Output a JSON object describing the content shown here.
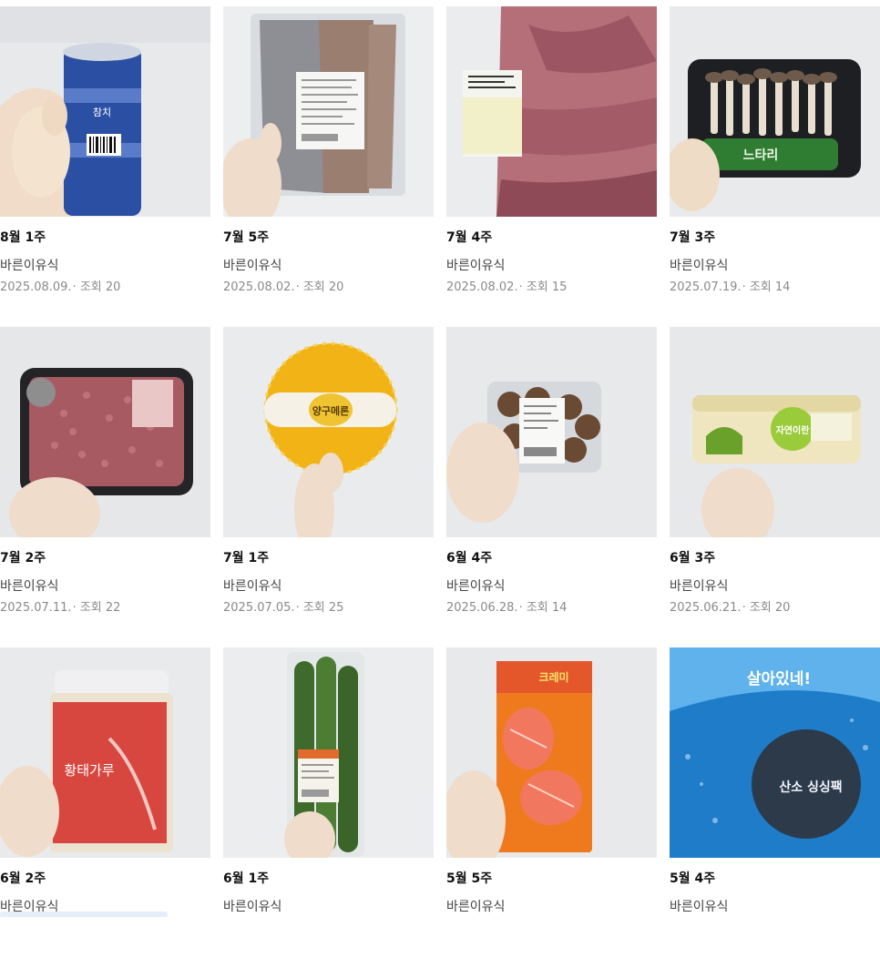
{
  "posts": [
    {
      "title": "8월 1주",
      "author": "바른이유식",
      "date": "2025.08.09.",
      "views_label": "조회",
      "views": "20",
      "image": "canned-tuna-icon",
      "bg": "#e8e9eb"
    },
    {
      "title": "7월 5주",
      "author": "바른이유식",
      "date": "2025.08.02.",
      "views_label": "조회",
      "views": "20",
      "image": "mackerel-pack-icon",
      "bg": "#eceef0"
    },
    {
      "title": "7월 4주",
      "author": "바른이유식",
      "date": "2025.08.02.",
      "views_label": "조회",
      "views": "15",
      "image": "pork-ribs-icon",
      "bg": "#ebeced"
    },
    {
      "title": "7월 3주",
      "author": "바른이유식",
      "date": "2025.07.19.",
      "views_label": "조회",
      "views": "14",
      "image": "mushroom-tray-icon",
      "bg": "#e9eaec"
    },
    {
      "title": "7월 2주",
      "author": "바른이유식",
      "date": "2025.07.11.",
      "views_label": "조회",
      "views": "22",
      "image": "minced-meat-icon",
      "bg": "#e6e7e9"
    },
    {
      "title": "7월 1주",
      "author": "바른이유식",
      "date": "2025.07.05.",
      "views_label": "조회",
      "views": "25",
      "image": "melon-icon",
      "bg": "#eaebed"
    },
    {
      "title": "6월 4주",
      "author": "바른이유식",
      "date": "2025.06.28.",
      "views_label": "조회",
      "views": "14",
      "image": "shiitake-pack-icon",
      "bg": "#e8e9eb"
    },
    {
      "title": "6월 3주",
      "author": "바른이유식",
      "date": "2025.06.21.",
      "views_label": "조회",
      "views": "20",
      "image": "egg-carton-icon",
      "bg": "#e7e8ea"
    },
    {
      "title": "6월 2주",
      "author": "바른이유식",
      "date": "",
      "views_label": "",
      "views": "",
      "image": "pollock-powder-jar-icon",
      "bg": "#e9eaec"
    },
    {
      "title": "6월 1주",
      "author": "바른이유식",
      "date": "",
      "views_label": "",
      "views": "",
      "image": "cucumber-icon",
      "bg": "#ecedef"
    },
    {
      "title": "5월 5주",
      "author": "바른이유식",
      "date": "",
      "views_label": "",
      "views": "",
      "image": "salmon-pack-icon",
      "bg": "#e8e9eb"
    },
    {
      "title": "5월 4주",
      "author": "바른이유식",
      "date": "",
      "views_label": "",
      "views": "",
      "image": "clam-bag-icon",
      "bg": "#e4e9ee"
    }
  ],
  "image_labels": {
    "tuna": "참치",
    "mushroom": "느타리",
    "melon": "양구메론",
    "egg": "자연이란",
    "pollock": "황태가루",
    "salmon": "크레미",
    "clam_top": "살아있네!",
    "clam_brand": "산소 싱싱팩"
  }
}
